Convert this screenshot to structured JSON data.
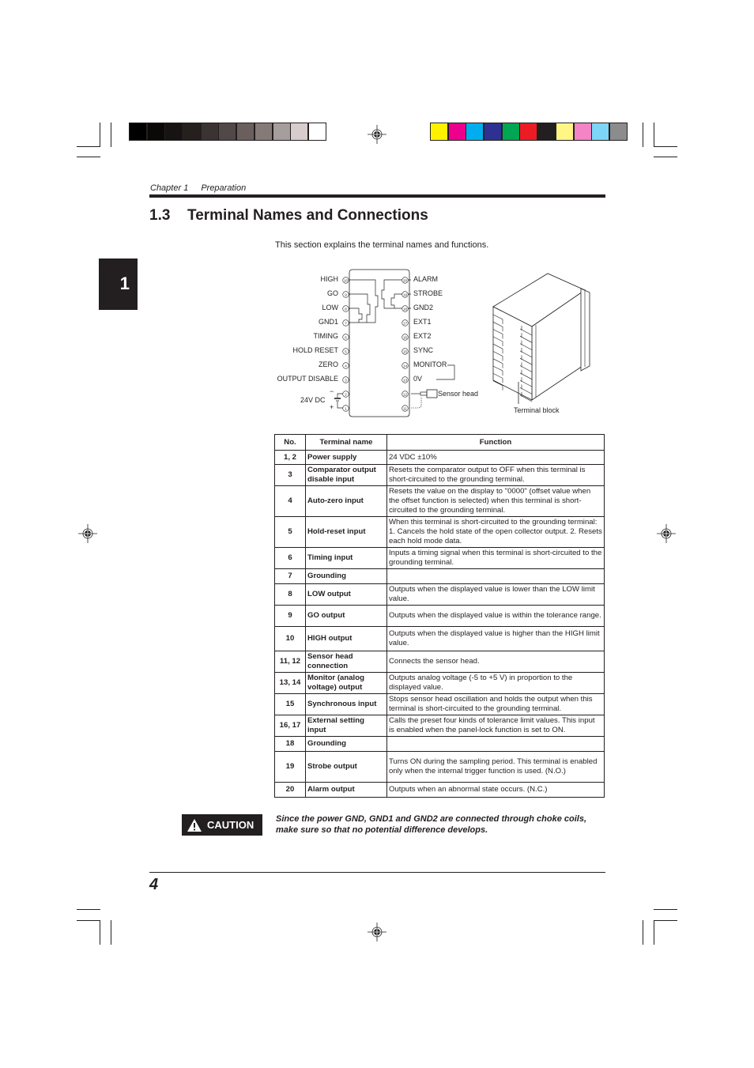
{
  "print_marks": {
    "gray_swatches": [
      "#000000",
      "#0b0908",
      "#171312",
      "#25201e",
      "#3b3331",
      "#514947",
      "#6b5f5d",
      "#857a78",
      "#a59e9d",
      "#d6cdcc",
      "#ffffff"
    ],
    "color_swatches": [
      "#fff200",
      "#ec008c",
      "#00aeef",
      "#2e3192",
      "#00a651",
      "#ed1c24",
      "#231f20",
      "#fff685",
      "#f384c6",
      "#7dd6f8",
      "#8c8c8c"
    ]
  },
  "header": {
    "chapter": "Chapter 1",
    "chapter_title": "Preparation"
  },
  "chapter_tab": "1",
  "section": {
    "number": "1.3",
    "title": "Terminal Names and Connections",
    "intro": "This section explains the terminal names and functions."
  },
  "diagram": {
    "left_terminals": [
      {
        "no": "10",
        "label": "HIGH"
      },
      {
        "no": "9",
        "label": "GO"
      },
      {
        "no": "8",
        "label": "LOW"
      },
      {
        "no": "7",
        "label": "GND1"
      },
      {
        "no": "6",
        "label": "TIMING"
      },
      {
        "no": "5",
        "label": "HOLD RESET"
      },
      {
        "no": "4",
        "label": "ZERO"
      },
      {
        "no": "3",
        "label": "OUTPUT DISABLE"
      },
      {
        "no": "2",
        "label": ""
      },
      {
        "no": "1",
        "label": ""
      }
    ],
    "right_terminals": [
      {
        "no": "20",
        "label": "ALARM"
      },
      {
        "no": "19",
        "label": "STROBE"
      },
      {
        "no": "18",
        "label": "GND2"
      },
      {
        "no": "17",
        "label": "EXT1"
      },
      {
        "no": "16",
        "label": "EXT2"
      },
      {
        "no": "15",
        "label": "SYNC"
      },
      {
        "no": "14",
        "label": "MONITOR"
      },
      {
        "no": "13",
        "label": "0V"
      },
      {
        "no": "12",
        "label": ""
      },
      {
        "no": "11",
        "label": ""
      }
    ],
    "power_label": "24V DC",
    "minus": "−",
    "plus": "+",
    "sensor_head_label": "Sensor head",
    "terminal_block_label": "Terminal block"
  },
  "table": {
    "headers": [
      "No.",
      "Terminal name",
      "Function"
    ],
    "rows": [
      {
        "no": "1, 2",
        "name": "Power supply",
        "function": "24 VDC ±10%"
      },
      {
        "no": "3",
        "name": "Comparator output disable input",
        "function": "Resets the comparator output to OFF when this terminal is short-circuited to the grounding terminal."
      },
      {
        "no": "4",
        "name": "Auto-zero input",
        "function": "Resets the value on the display to \"0000\" (offset value when the offset function is selected) when this terminal is short-circuited to the grounding terminal."
      },
      {
        "no": "5",
        "name": "Hold-reset input",
        "function": "When this terminal is short-circuited to the grounding terminal: 1. Cancels the hold state of the open collector output. 2. Resets each hold mode data."
      },
      {
        "no": "6",
        "name": "Timing input",
        "function": "Inputs a timing signal when this terminal is short-circuited to the grounding terminal."
      },
      {
        "no": "7",
        "name": "Grounding",
        "function": ""
      },
      {
        "no": "8",
        "name": "LOW output",
        "function": "Outputs when the displayed value is lower than the LOW limit value."
      },
      {
        "no": "9",
        "name": "GO output",
        "function": "Outputs when the displayed value is within the tolerance range."
      },
      {
        "no": "10",
        "name": "HIGH output",
        "function": "Outputs when the displayed value is higher than the HIGH limit value."
      },
      {
        "no": "11, 12",
        "name": "Sensor head connection",
        "function": "Connects the sensor head."
      },
      {
        "no": "13, 14",
        "name": "Monitor (analog voltage) output",
        "function": "Outputs analog voltage (-5 to +5 V) in proportion to the displayed value."
      },
      {
        "no": "15",
        "name": "Synchronous input",
        "function": "Stops sensor head oscillation and holds the output when this terminal is short-circuited to the grounding terminal."
      },
      {
        "no": "16, 17",
        "name": "External setting input",
        "function": "Calls the preset four kinds of tolerance limit values. This input is enabled when the panel-lock function is set to ON."
      },
      {
        "no": "18",
        "name": "Grounding",
        "function": ""
      },
      {
        "no": "19",
        "name": "Strobe output",
        "function": "Turns ON during the sampling period. This terminal is enabled only when the internal trigger function is used. (N.O.)"
      },
      {
        "no": "20",
        "name": "Alarm output",
        "function": "Outputs when an abnormal state occurs. (N.C.)"
      }
    ]
  },
  "caution": {
    "label": "CAUTION",
    "icon": "warning-triangle-icon",
    "text_line1": "Since the power GND, GND1 and GND2 are connected through choke coils,",
    "text_line2": "make sure so that no potential difference develops."
  },
  "footer": {
    "page_number": "4"
  }
}
